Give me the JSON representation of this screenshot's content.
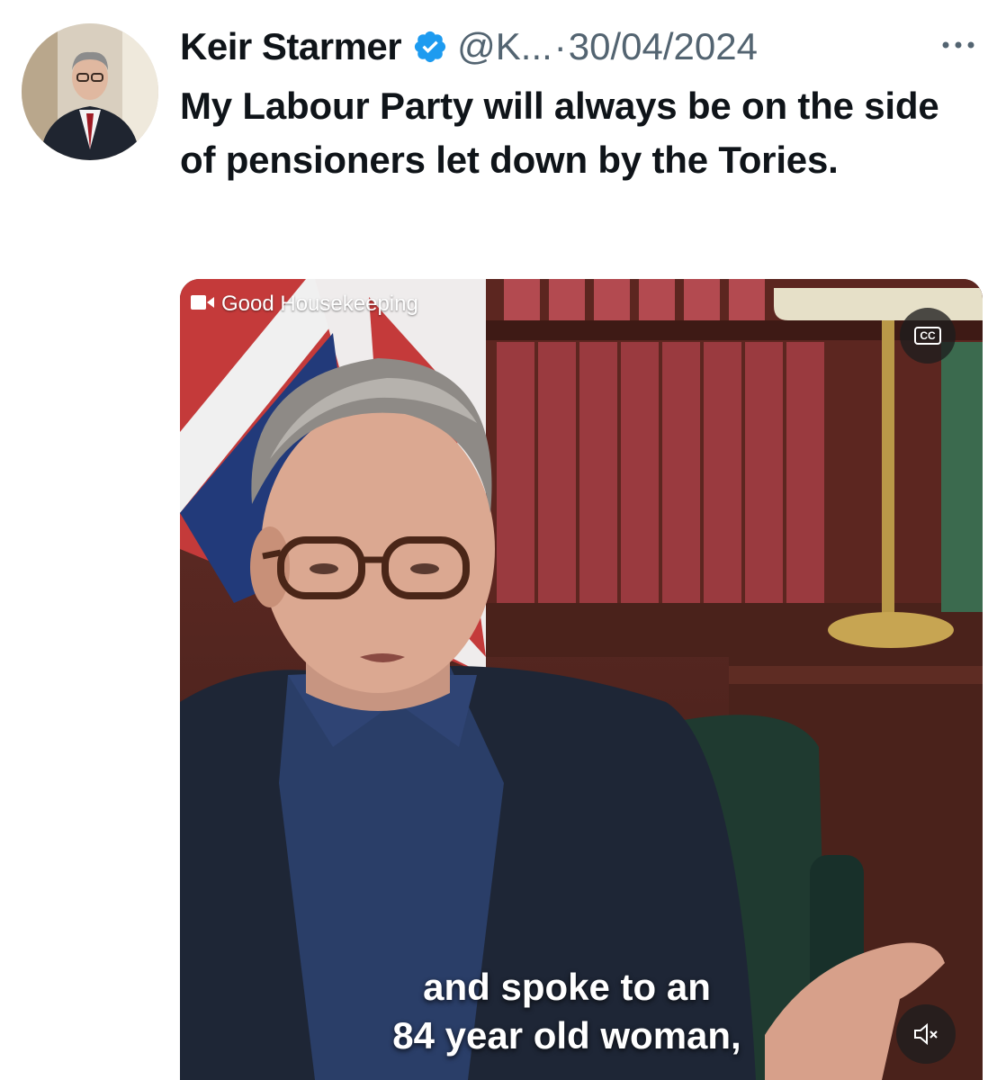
{
  "tweet": {
    "author": {
      "display_name": "Keir Starmer",
      "verified_icon": "verified-badge-icon",
      "handle": "@K...",
      "separator": "·",
      "date": "30/04/2024",
      "avatar_icon": "profile-photo"
    },
    "more_icon": "more-options-icon",
    "text": "My Labour Party will always be on the side of pensioners let down by the Tories.",
    "media": {
      "source_icon": "video-camera-icon",
      "source_label": "Good Housekeeping",
      "cc_label": "CC",
      "caption_line1": "and spoke to an",
      "caption_line2": "84 year old woman,",
      "mute_icon": "speaker-muted-icon"
    }
  },
  "colors": {
    "verified_blue": "#1d9bf0",
    "text_primary": "#0f1419",
    "text_secondary": "#536471"
  }
}
